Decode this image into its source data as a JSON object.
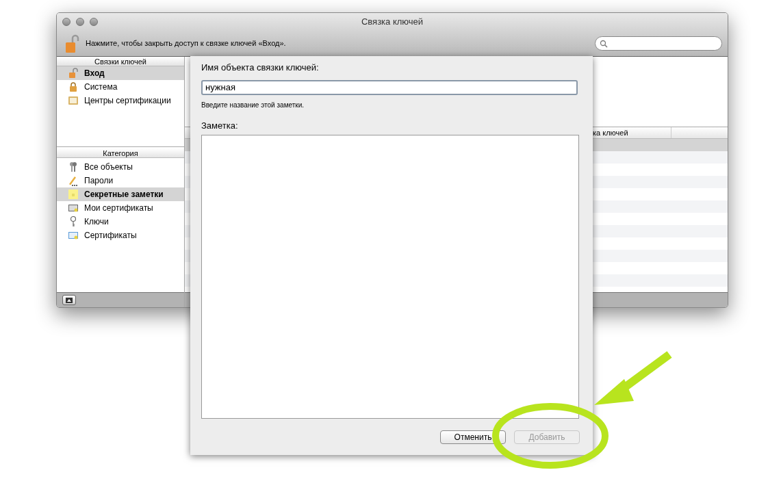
{
  "window": {
    "title": "Связка ключей",
    "lock_message": "Нажмите, чтобы закрыть доступ к связке ключей «Вход»."
  },
  "sidebar": {
    "keychains": {
      "header": "Связки ключей",
      "items": [
        {
          "label": "Вход",
          "selected": true
        },
        {
          "label": "Система",
          "selected": false
        },
        {
          "label": "Центры сертификации",
          "selected": false
        }
      ]
    },
    "categories": {
      "header": "Категория",
      "items": [
        {
          "label": "Все объекты",
          "selected": false
        },
        {
          "label": "Пароли",
          "selected": false
        },
        {
          "label": "Секретные заметки",
          "selected": true
        },
        {
          "label": "Мои сертификаты",
          "selected": false
        },
        {
          "label": "Ключи",
          "selected": false
        },
        {
          "label": "Сертификаты",
          "selected": false
        }
      ]
    }
  },
  "table": {
    "columns": [
      "ка ключей"
    ]
  },
  "sheet": {
    "name_label": "Имя объекта связки ключей:",
    "name_value": "нужная",
    "hint": "Введите название этой заметки.",
    "note_label": "Заметка:",
    "buttons": [
      {
        "label": "Отменить",
        "disabled": false
      },
      {
        "label": "Добавить",
        "disabled": true
      }
    ]
  }
}
